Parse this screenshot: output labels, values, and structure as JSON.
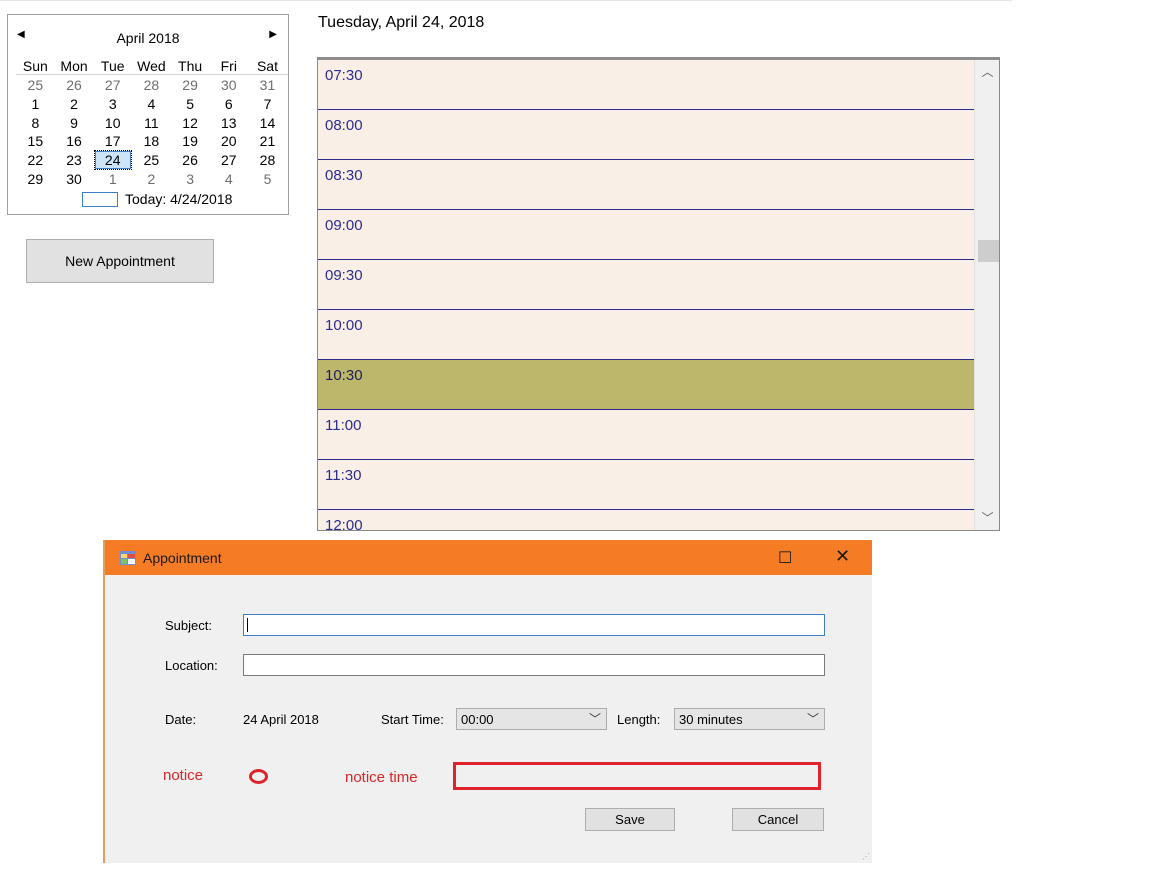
{
  "calendar": {
    "month_title": "April 2018",
    "prev_label": "◀",
    "next_label": "▶",
    "weekdays": [
      "Sun",
      "Mon",
      "Tue",
      "Wed",
      "Thu",
      "Fri",
      "Sat"
    ],
    "weeks": [
      [
        "25",
        "26",
        "27",
        "28",
        "29",
        "30",
        "31"
      ],
      [
        "1",
        "2",
        "3",
        "4",
        "5",
        "6",
        "7"
      ],
      [
        "8",
        "9",
        "10",
        "11",
        "12",
        "13",
        "14"
      ],
      [
        "15",
        "16",
        "17",
        "18",
        "19",
        "20",
        "21"
      ],
      [
        "22",
        "23",
        "24",
        "25",
        "26",
        "27",
        "28"
      ],
      [
        "29",
        "30",
        "1",
        "2",
        "3",
        "4",
        "5"
      ]
    ],
    "today_label": "Today: 4/24/2018"
  },
  "new_appointment_label": "New Appointment",
  "dayview": {
    "date_title": "Tuesday, April 24, 2018",
    "slots": [
      "07:30",
      "08:00",
      "08:30",
      "09:00",
      "09:30",
      "10:00",
      "10:30",
      "11:00",
      "11:30",
      "12:00"
    ],
    "selected_slot": "10:30",
    "colors": {
      "background": "#f9efe6",
      "selected": "#bdb76b",
      "line": "#2c2c8e"
    }
  },
  "dialog": {
    "title": "Appointment",
    "title_bar_color": "#f57b24",
    "subject_label": "Subject:",
    "subject_value": "",
    "location_label": "Location:",
    "location_value": "",
    "date_label": "Date:",
    "date_value": "24 April 2018",
    "start_time_label": "Start Time:",
    "start_time_value": "00:00",
    "length_label": "Length:",
    "length_value": "30 minutes",
    "notice_label": "notice",
    "notice_time_label": "notice time",
    "save_label": "Save",
    "cancel_label": "Cancel",
    "annotation_color": "#e0232a"
  }
}
